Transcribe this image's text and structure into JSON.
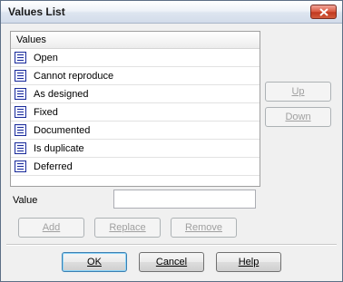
{
  "window": {
    "title": "Values List"
  },
  "list": {
    "column_header": "Values",
    "items": [
      {
        "label": "Open"
      },
      {
        "label": "Cannot reproduce"
      },
      {
        "label": "As designed"
      },
      {
        "label": "Fixed"
      },
      {
        "label": "Documented"
      },
      {
        "label": "Is duplicate"
      },
      {
        "label": "Deferred"
      }
    ],
    "item_icon": "list-value-icon"
  },
  "side_buttons": {
    "up_label": "Up",
    "down_label": "Down"
  },
  "value_field": {
    "label": "Value",
    "value": ""
  },
  "edit_buttons": {
    "add_label": "Add",
    "replace_label": "Replace",
    "remove_label": "Remove"
  },
  "dialog_buttons": {
    "ok_label": "OK",
    "cancel_label": "Cancel",
    "help_label": "Help"
  },
  "colors": {
    "icon": "#1c2d9a",
    "close_button": "#c0381f",
    "default_button_border": "#3c7fb1"
  }
}
